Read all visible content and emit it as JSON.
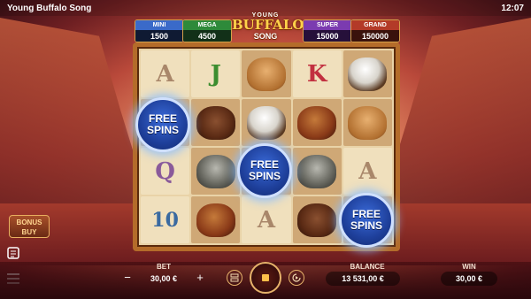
{
  "app": {
    "title": "Young Buffalo Song",
    "clock": "12:07"
  },
  "logo": {
    "line1": "YOUNG",
    "line2": "BUFFALO",
    "line3": "SONG"
  },
  "jackpots": [
    {
      "label": "MINI",
      "value": "1500",
      "color": "#3a6ac9"
    },
    {
      "label": "MEGA",
      "value": "4500",
      "color": "#2e8a3a"
    },
    {
      "label": "SUPER",
      "value": "15000",
      "color": "#7b3bb0"
    },
    {
      "label": "GRAND",
      "value": "150000",
      "color": "#b33a28"
    }
  ],
  "reels": {
    "rows": [
      [
        "A",
        "J",
        "cougar",
        "K",
        "eagle"
      ],
      [
        "free-spins",
        "bison",
        "eagle",
        "horse",
        "cougar"
      ],
      [
        "Q",
        "wolf",
        "free-spins",
        "wolf",
        "A"
      ],
      [
        "10",
        "horse",
        "A",
        "bison",
        "free-spins"
      ]
    ],
    "free_spins_badge": {
      "line1": "FREE",
      "line2": "SPINS"
    }
  },
  "bonus_buy": {
    "line1": "BONUS",
    "line2": "BUY"
  },
  "bottom": {
    "bet_label": "BET",
    "bet_value": "30,00 €",
    "minus": "−",
    "plus": "+",
    "balance_label": "BALANCE",
    "balance_value": "13 531,00 €",
    "win_label": "WIN",
    "win_value": "30,00 €"
  },
  "icons": {
    "paytable": "paytable-icon",
    "menu": "menu-icon",
    "autoplay": "autoplay-icon",
    "turbo": "turbo-icon",
    "spin": "stop-spin-icon"
  }
}
